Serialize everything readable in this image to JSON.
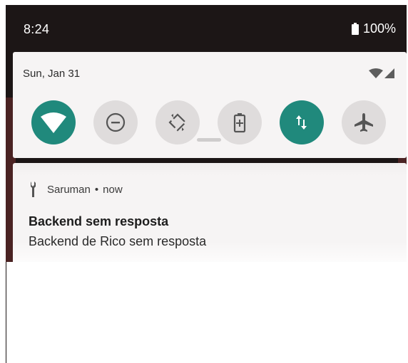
{
  "status_bar": {
    "time": "8:24",
    "battery_pct": "100%",
    "battery_icon": "battery-full-icon"
  },
  "quick_settings": {
    "date": "Sun, Jan 31",
    "signal_icons": [
      "wifi-icon",
      "cellular-signal-icon"
    ],
    "tiles": [
      {
        "name": "wifi",
        "icon": "wifi-icon",
        "state": "on"
      },
      {
        "name": "do-not-disturb",
        "icon": "do-not-disturb-icon",
        "state": "off"
      },
      {
        "name": "auto-rotate",
        "icon": "auto-rotate-icon",
        "state": "off"
      },
      {
        "name": "battery-saver",
        "icon": "battery-saver-icon",
        "state": "off"
      },
      {
        "name": "mobile-data",
        "icon": "mobile-data-icon",
        "state": "on"
      },
      {
        "name": "airplane-mode",
        "icon": "airplane-icon",
        "state": "off"
      }
    ],
    "accent_color": "#20897c"
  },
  "notification": {
    "app_icon": "wrench-icon",
    "app_name": "Saruman",
    "separator": "•",
    "time": "now",
    "title": "Backend sem resposta",
    "text": "Backend de Rico sem resposta"
  }
}
